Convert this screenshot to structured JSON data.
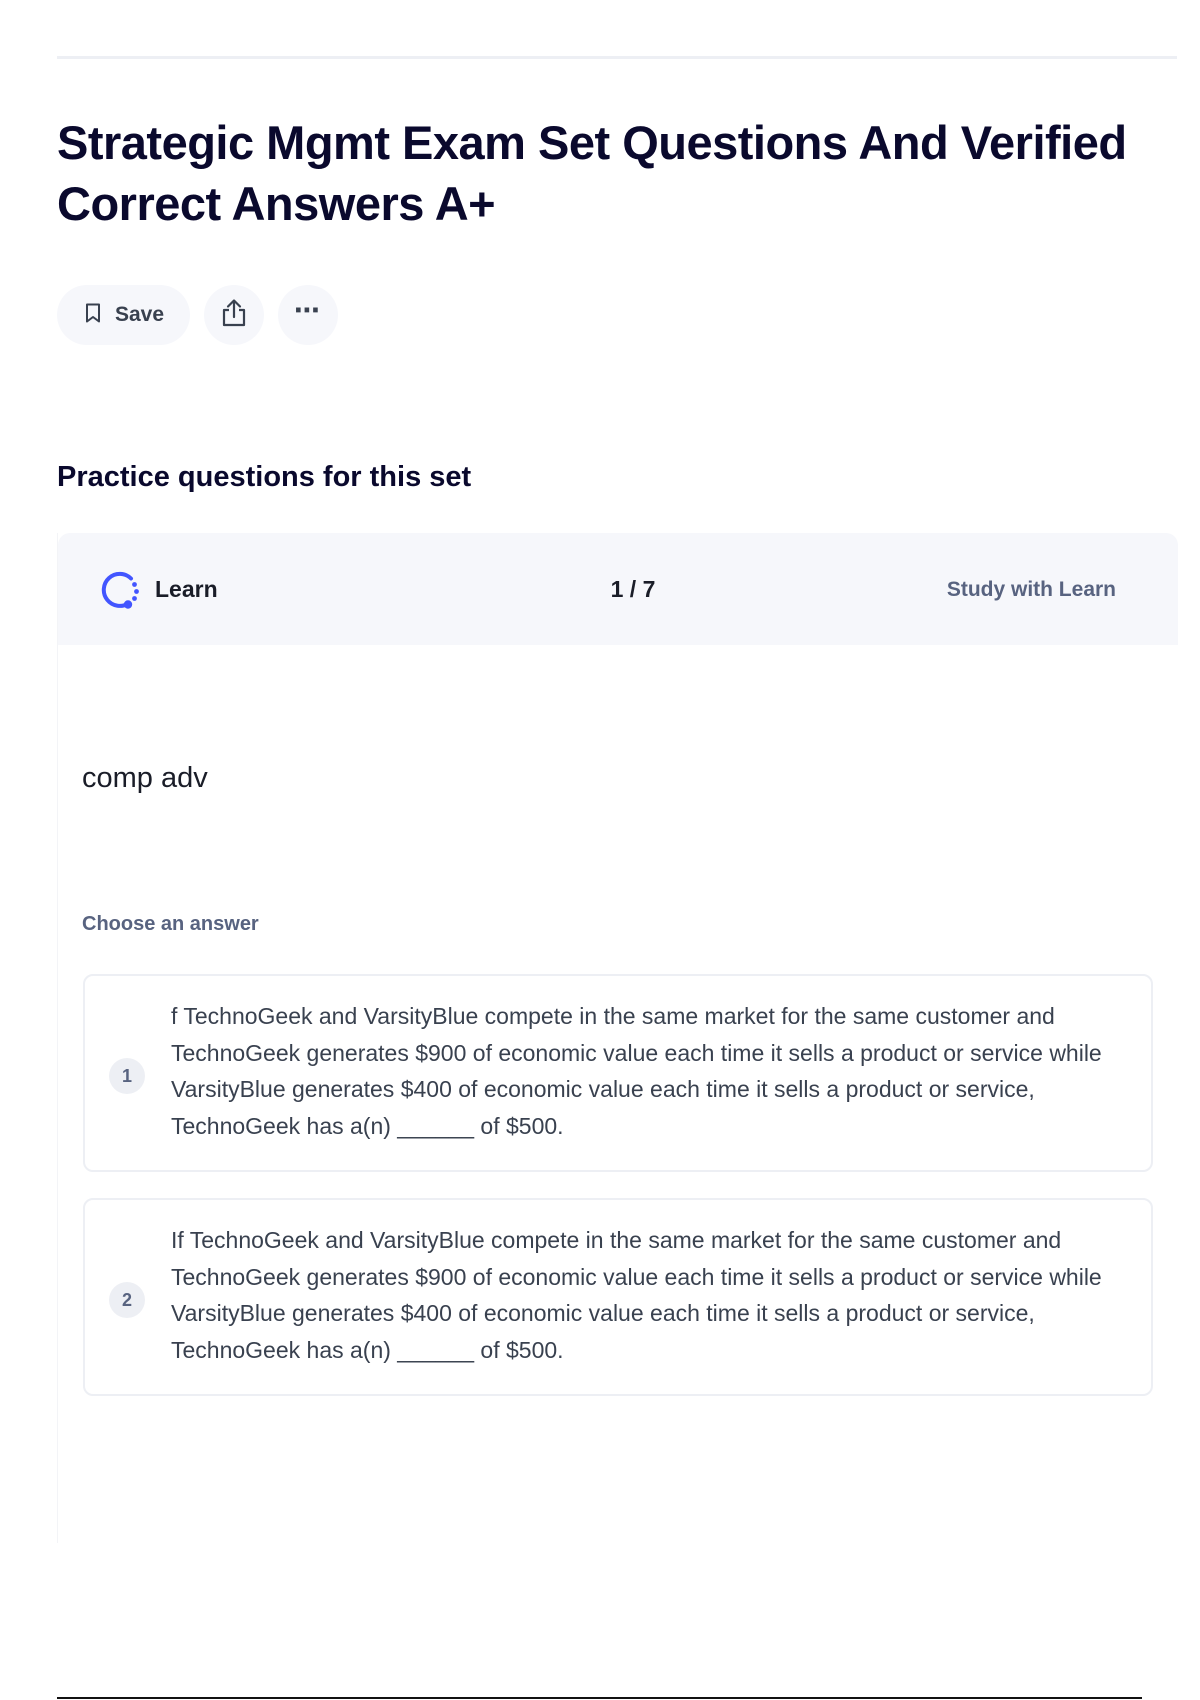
{
  "page": {
    "title": "Strategic Mgmt Exam Set Questions And Verified Correct Answers A+"
  },
  "actions": {
    "save_label": "Save"
  },
  "practice": {
    "section_title": "Practice questions for this set",
    "header": {
      "mode_label": "Learn",
      "progress": "1 / 7",
      "study_link": "Study with Learn"
    },
    "question": {
      "prompt": "comp adv",
      "choose_label": "Choose an answer",
      "options": [
        {
          "number": "1",
          "text": "f TechnoGeek and VarsityBlue compete in the same market for the same customer and TechnoGeek generates $900 of economic value each time it sells a product or service while VarsityBlue generates $400 of economic value each time it sells a product or service, TechnoGeek has a(n) ______ of $500."
        },
        {
          "number": "2",
          "text": "If TechnoGeek and VarsityBlue compete in the same market for the same customer and TechnoGeek generates $900 of economic value each time it sells a product or service while VarsityBlue generates $400 of economic value each time it sells a product or service, TechnoGeek has a(n) ______ of $500."
        }
      ]
    }
  },
  "icons": {
    "save": "bookmark-icon",
    "share": "share-icon",
    "more": "more-options-icon",
    "learn": "learn-mode-icon"
  },
  "colors": {
    "title_text": "#0a092d",
    "muted_text": "#586380",
    "body_text": "#39414f",
    "surface": "#f6f7fb",
    "border": "#edeff4",
    "accent": "#4255ff"
  }
}
